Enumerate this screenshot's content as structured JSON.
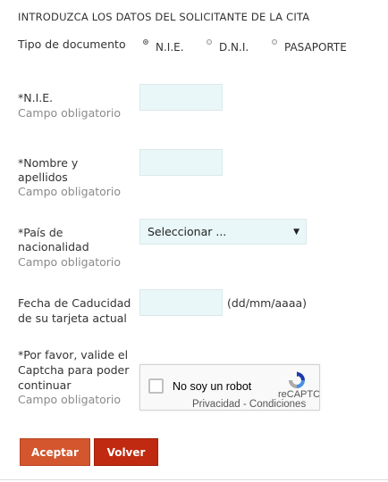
{
  "header": {
    "title": "INTRODUZCA LOS DATOS DEL SOLICITANTE DE LA CITA"
  },
  "document_type": {
    "label": "Tipo de documento",
    "options": [
      {
        "label": "N.I.E.",
        "checked": true
      },
      {
        "label": "D.N.I.",
        "checked": false
      },
      {
        "label": "PASAPORTE",
        "checked": false
      }
    ]
  },
  "nie": {
    "label": "*N.I.E.",
    "hint": "Campo obligatorio",
    "value": ""
  },
  "name": {
    "label_line1": "*Nombre y",
    "label_line2": "apellidos",
    "hint": "Campo obligatorio",
    "value": ""
  },
  "nationality": {
    "label_line1": "*País de",
    "label_line2": "nacionalidad",
    "hint": "Campo obligatorio",
    "selected": "Seleccionar ...",
    "arrow": "▼"
  },
  "expiry": {
    "label_line1": "Fecha de Caducidad",
    "label_line2": "de su tarjeta actual",
    "value": "",
    "format": "(dd/mm/aaaa)"
  },
  "captcha": {
    "label_line1": "*Por favor, valide el",
    "label_line2": "Captcha para poder",
    "label_line3": "continuar",
    "hint": "Campo obligatorio",
    "robot_text": "No soy un robot",
    "brand": "reCAPTCHA",
    "privacy": "Privacidad - Condiciones"
  },
  "buttons": {
    "accept": "Aceptar",
    "back": "Volver"
  },
  "colors": {
    "field_bg": "#e9f7f8",
    "accept_bg": "#d3562f",
    "back_bg": "#c02a10",
    "hint_text": "#8a8a8a"
  }
}
